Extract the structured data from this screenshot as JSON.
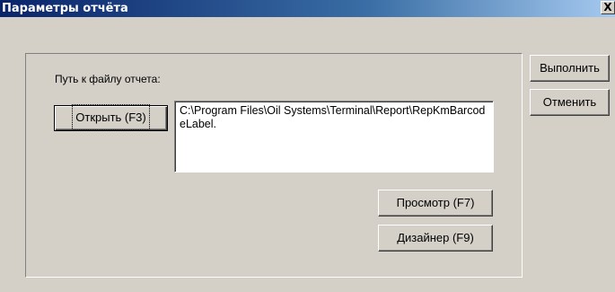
{
  "window": {
    "title": "Параметры отчёта",
    "close_glyph": "X"
  },
  "form": {
    "path_label": "Путь к файлу отчета:",
    "open_button": "Открыть (F3)",
    "path_value": "C:\\Program Files\\Oil Systems\\Terminal\\Report\\RepKmBarcodeLabel.",
    "preview_button": "Просмотр (F7)",
    "designer_button": "Дизайнер (F9)"
  },
  "actions": {
    "execute": "Выполнить",
    "cancel": "Отменить"
  },
  "colors": {
    "face": "#d4d0c8",
    "title_start": "#0a246a",
    "title_end": "#a6caf0"
  }
}
